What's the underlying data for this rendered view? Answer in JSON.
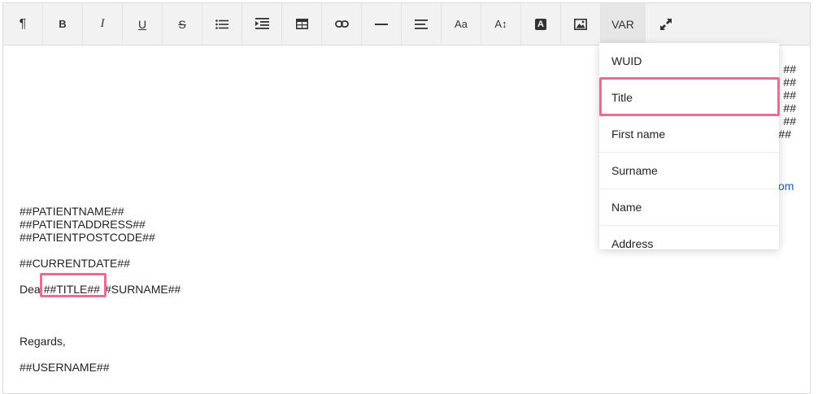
{
  "toolbar": {
    "buttons": [
      {
        "name": "paragraph",
        "glyph": "¶"
      },
      {
        "name": "bold",
        "glyph": "B"
      },
      {
        "name": "italic",
        "glyph": "I"
      },
      {
        "name": "underline",
        "glyph": "U"
      },
      {
        "name": "strikethrough",
        "glyph": "S"
      },
      {
        "name": "unordered-list",
        "glyph": ""
      },
      {
        "name": "indent",
        "glyph": ""
      },
      {
        "name": "table",
        "glyph": ""
      },
      {
        "name": "link",
        "glyph": ""
      },
      {
        "name": "horizontal-rule",
        "glyph": ""
      },
      {
        "name": "align",
        "glyph": ""
      },
      {
        "name": "font-size",
        "glyph": "Aa"
      },
      {
        "name": "line-height",
        "glyph": "A↕"
      },
      {
        "name": "text-color",
        "glyph": "A"
      },
      {
        "name": "image",
        "glyph": ""
      }
    ],
    "var_label": "VAR"
  },
  "document": {
    "patient_name": "##PATIENTNAME##",
    "patient_address": "##PATIENTADDRESS##",
    "patient_postcode": "##PATIENTPOSTCODE##",
    "current_date": "##CURRENTDATE##",
    "dear_prefix": "Dea",
    "title_var": "##TITLE##",
    "surname_var": "#SURNAME##",
    "regards": "Regards,",
    "username": "##USERNAME##",
    "right_fragments": [
      "##",
      "##",
      "##",
      "##",
      "##",
      "##"
    ],
    "right_link_fragment": "om"
  },
  "dropdown": {
    "items": [
      "WUID",
      "Title",
      "First name",
      "Surname",
      "Name",
      "Address"
    ],
    "selected_index": 1
  },
  "colors": {
    "highlight": "#ec6a96",
    "link": "#1a5fb4",
    "toolbar_bg": "#f2f2f2"
  }
}
